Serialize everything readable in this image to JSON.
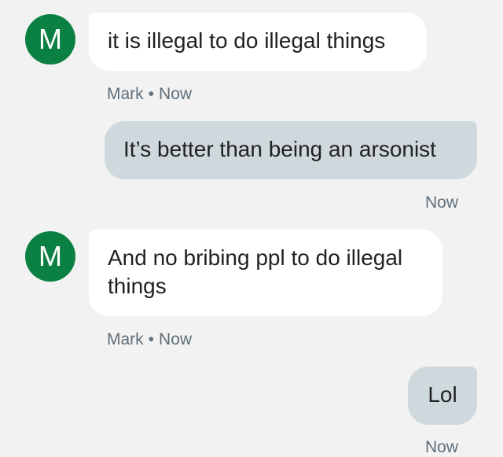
{
  "messages": [
    {
      "direction": "in",
      "avatar_letter": "M",
      "text": "it is illegal to do illegal things",
      "sender": "Mark",
      "separator": "•",
      "time": "Now"
    },
    {
      "direction": "out",
      "text": "It’s better than being an arsonist",
      "time": "Now"
    },
    {
      "direction": "in",
      "avatar_letter": "M",
      "text": "And no bribing ppl to do illegal things",
      "sender": "Mark",
      "separator": "•",
      "time": "Now"
    },
    {
      "direction": "out",
      "text": "Lol",
      "time": "Now"
    }
  ],
  "colors": {
    "avatar": "#0b8043",
    "incoming_bubble": "#ffffff",
    "outgoing_bubble": "#cfd8dc",
    "meta_text": "#5f6f7b",
    "background": "#f2f2f2"
  }
}
